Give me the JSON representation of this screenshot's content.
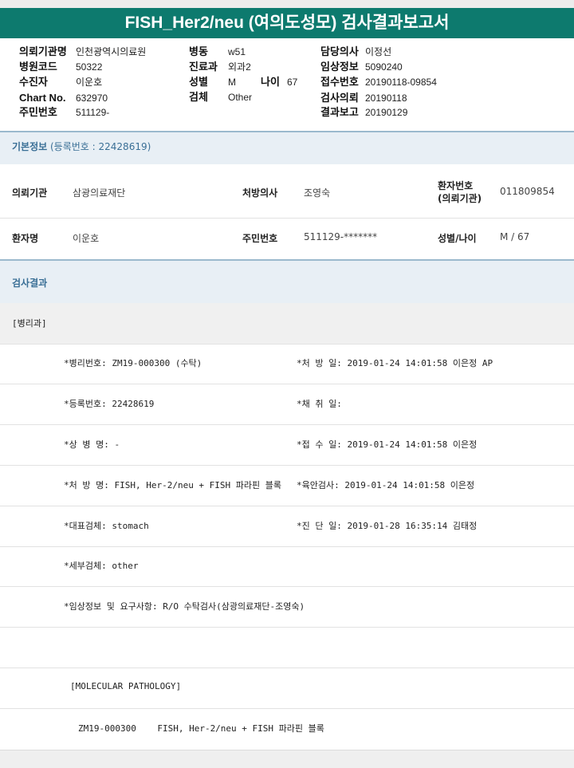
{
  "title": "FISH_Her2/neu (여의도성모) 검사결과보고서",
  "header": {
    "col1": [
      {
        "label": "의뢰기관명",
        "value": "인천광역시의료원"
      },
      {
        "label": "병원코드",
        "value": "50322"
      },
      {
        "label": "수진자",
        "value": "이운호"
      },
      {
        "label": "Chart No.",
        "value": "632970"
      },
      {
        "label": "주민번호",
        "value": "511129-"
      }
    ],
    "col2": [
      {
        "label": "병동",
        "value": "w51"
      },
      {
        "label": "진료과",
        "value": "외과2"
      },
      {
        "label": "성별",
        "value": "M"
      },
      {
        "label": "검체",
        "value": "Other"
      }
    ],
    "age": {
      "label": "나이",
      "value": "67"
    },
    "col3": [
      {
        "label": "담당의사",
        "value": "이정선"
      },
      {
        "label": "임상정보",
        "value": "5090240"
      },
      {
        "label": "접수번호",
        "value": "20190118-09854"
      },
      {
        "label": "검사의뢰",
        "value": "20190118"
      },
      {
        "label": "결과보고",
        "value": "20190129"
      }
    ]
  },
  "basic_info": {
    "title": "기본정보",
    "reg_no": "(등록번호 : 22428619)",
    "row1": {
      "requesting_org_label": "의뢰기관",
      "requesting_org_value": "삼광의료재단",
      "doctor_label": "처방의사",
      "doctor_value": "조영숙",
      "patient_no_label_1": "환자번호",
      "patient_no_label_2": "(의뢰기관)",
      "patient_no_value": "011809854"
    },
    "row2": {
      "patient_label": "환자명",
      "patient_value": "이운호",
      "resident_label": "주민번호",
      "resident_value": "511129-*******",
      "sex_age_label": "성별/나이",
      "sex_age_value": "M / 67"
    }
  },
  "results": {
    "title": "검사결과",
    "department": "[병리과]",
    "lines": [
      {
        "left": "*병리번호: ZM19-000300 (수탁)",
        "right": "*처 방 일: 2019-01-24 14:01:58  이은정 AP"
      },
      {
        "left": "*등록번호: 22428619",
        "right": "*채 취 일:"
      },
      {
        "left": "*상 병 명: -",
        "right": "*접 수 일: 2019-01-24 14:01:58  이은정"
      },
      {
        "left": "*처 방 명: FISH, Her-2/neu + FISH 파라핀 블록",
        "right": "*육안검사: 2019-01-24 14:01:58  이은정"
      },
      {
        "left": "*대표검체: stomach",
        "right": "*진 단 일: 2019-01-28 16:35:14  김태정"
      },
      {
        "left": "*세부검체: other",
        "right": ""
      },
      {
        "left": "*임상정보 및 요구사항: R/O 수탁검사(삼광의료재단-조영숙)",
        "right": ""
      }
    ],
    "molecular_header": "[MOLECULAR PATHOLOGY]",
    "molecular_line": "ZM19-000300    FISH, Her-2/neu + FISH 파라핀 블록"
  }
}
